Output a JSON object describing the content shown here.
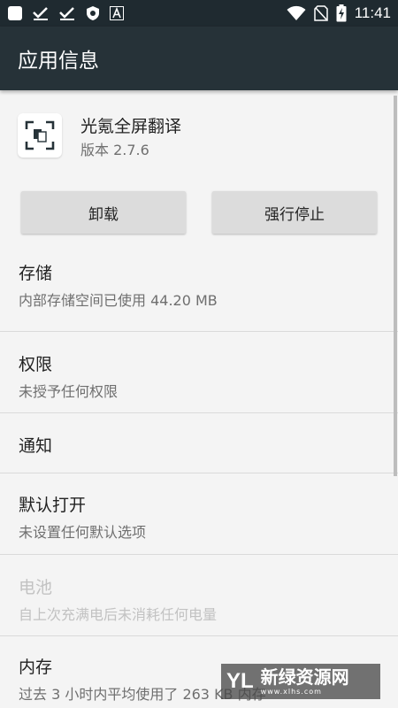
{
  "status_bar": {
    "time": "11:41",
    "left_icons": [
      "notification-square-icon",
      "download-done-icon",
      "download-done-icon",
      "shield-icon",
      "font-a-icon"
    ],
    "right_icons": [
      "wifi-icon",
      "no-sim-icon",
      "battery-charging-icon"
    ]
  },
  "app_bar": {
    "title": "应用信息"
  },
  "app": {
    "name": "光氪全屏翻译",
    "version": "版本 2.7.6"
  },
  "buttons": {
    "uninstall": "卸载",
    "force_stop": "强行停止"
  },
  "sections": [
    {
      "title": "存储",
      "subtitle": "内部存储空间已使用 44.20 MB",
      "enabled": true
    },
    {
      "title": "权限",
      "subtitle": "未授予任何权限",
      "enabled": true
    },
    {
      "title": "通知",
      "subtitle": "",
      "enabled": true
    },
    {
      "title": "默认打开",
      "subtitle": "未设置任何默认选项",
      "enabled": true
    },
    {
      "title": "电池",
      "subtitle": "自上次充满电后未消耗任何电量",
      "enabled": false
    },
    {
      "title": "内存",
      "subtitle": "过去 3 小时内平均使用了 263 KB 内存",
      "enabled": true
    }
  ],
  "watermark": {
    "name": "新绿资源网",
    "url": "www.xlhs.com"
  },
  "colors": {
    "app_bar": "#263238",
    "status_bar": "#1f2a30",
    "background": "#f4f4f4"
  }
}
